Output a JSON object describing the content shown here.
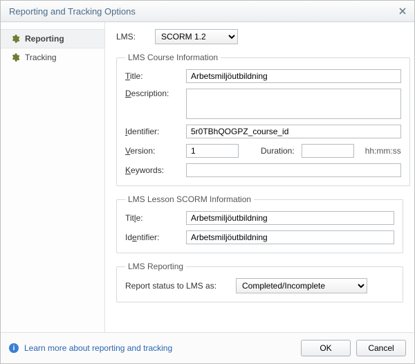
{
  "window": {
    "title": "Reporting and Tracking Options"
  },
  "sidebar": {
    "items": [
      {
        "label": "Reporting"
      },
      {
        "label": "Tracking"
      }
    ]
  },
  "lms": {
    "label": "LMS:",
    "value": "SCORM 1.2"
  },
  "groups": {
    "course": {
      "legend": "LMS Course Information",
      "title_label": "Title:",
      "title_value": "Arbetsmiljöutbildning",
      "desc_label": "Description:",
      "desc_value": "",
      "id_label": "Identifier:",
      "id_value": "5r0TBhQOGPZ_course_id",
      "version_label": "Version:",
      "version_value": "1",
      "duration_label": "Duration:",
      "duration_value": "",
      "duration_hint": "hh:mm:ss",
      "keywords_label": "Keywords:",
      "keywords_value": ""
    },
    "lesson": {
      "legend": "LMS Lesson SCORM Information",
      "title_label": "Title:",
      "title_value": "Arbetsmiljöutbildning",
      "id_label": "Identifier:",
      "id_value": "Arbetsmiljöutbildning"
    },
    "reporting": {
      "legend": "LMS Reporting",
      "status_label": "Report status to LMS as:",
      "status_value": "Completed/Incomplete"
    }
  },
  "footer": {
    "learn_more": "Learn more about reporting and tracking",
    "ok": "OK",
    "cancel": "Cancel"
  }
}
